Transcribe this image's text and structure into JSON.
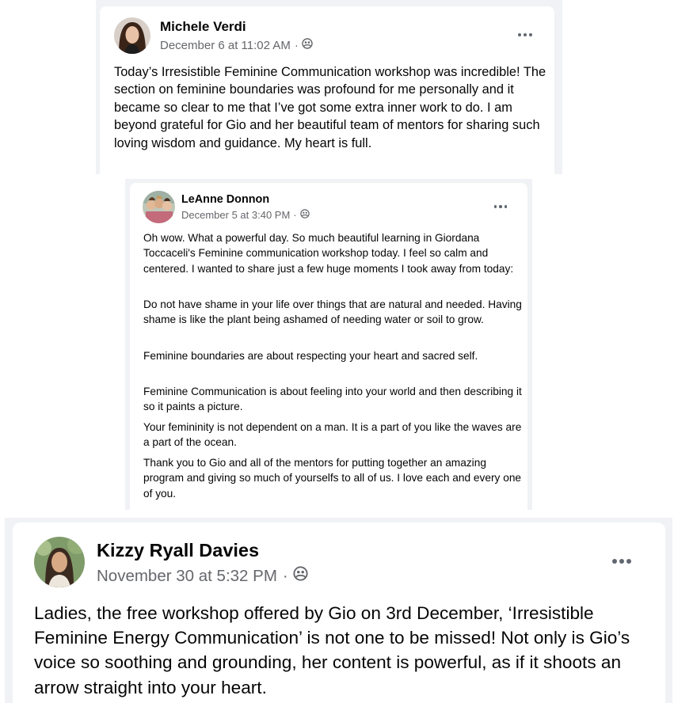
{
  "posts": [
    {
      "author": "Michele Verdi",
      "timestamp": "December 6 at 11:02 AM",
      "separator": "·",
      "audience_icon": "friends-icon",
      "menu_icon": "more-options-icon",
      "paragraphs": [
        "Today’s Irresistible Feminine Communication workshop was incredible!  The section on feminine boundaries was profound for me personally and it became so clear to me that I’ve got some extra inner work to do. I am beyond grateful for Gio and her beautiful team of mentors for sharing such loving wisdom and guidance. My heart is full."
      ]
    },
    {
      "author": "LeAnne Donnon",
      "timestamp": "December 5 at 3:40 PM",
      "separator": "·",
      "audience_icon": "friends-icon",
      "menu_icon": "more-options-icon",
      "paragraphs": [
        "Oh wow. What a powerful day. So much beautiful learning in Giordana Toccaceli's Feminine communication workshop today. I feel so calm and centered. I wanted to share just a few huge moments I took away from today:",
        "Do not have shame in your life over things that are natural and needed. Having shame is like the plant being ashamed of needing water or soil to grow.",
        "Feminine boundaries are about respecting your heart and sacred self.",
        "Feminine Communication is about feeling into your world and then describing it so it paints a picture.",
        "Your femininity is not dependent on a man. It is a part of you like the waves are a part of the ocean.",
        "Thank you to Gio and all of the mentors for putting together an amazing program and giving so much of yourselfs to all of us. I love each and every one of you."
      ]
    },
    {
      "author": "Kizzy Ryall Davies",
      "timestamp": "November 30 at 5:32 PM",
      "separator": "·",
      "audience_icon": "friends-icon",
      "menu_icon": "more-options-icon",
      "paragraphs": [
        "Ladies, the free workshop offered by Gio on 3rd December, ‘Irresistible Feminine Energy Communication’ is not one to be missed! Not only is Gio’s voice so soothing and grounding, her content is powerful, as if it shoots an arrow straight into your heart."
      ]
    }
  ],
  "colors": {
    "text_primary": "#050505",
    "text_secondary": "#65676b",
    "panel_background": "#f0f2f5",
    "card_background": "#ffffff",
    "icon_gray": "#606770"
  }
}
